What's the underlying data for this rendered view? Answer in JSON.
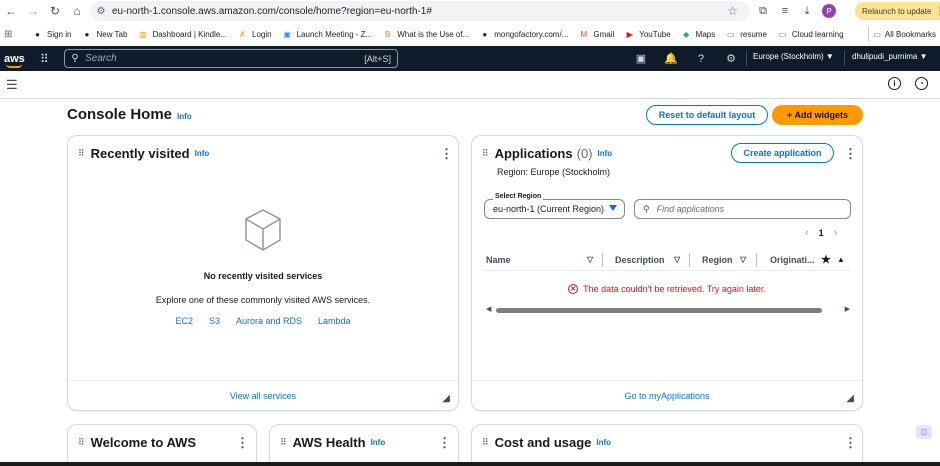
{
  "browser": {
    "url": "eu-north-1.console.aws.amazon.com/console/home?region=eu-north-1#",
    "relaunch_label": "Relaunch to update",
    "profile_initial": "P",
    "bookmarks": [
      {
        "label": "Sign in",
        "icon": "github-icon",
        "glyph": "●",
        "color": "#24292f"
      },
      {
        "label": "New Tab",
        "icon": "github-icon",
        "glyph": "●",
        "color": "#24292f"
      },
      {
        "label": "Dashboard | Kindle...",
        "icon": "chart-icon",
        "glyph": "▥",
        "color": "#f29900"
      },
      {
        "label": "Login",
        "icon": "person-icon",
        "glyph": "✗",
        "color": "#f29900"
      },
      {
        "label": "Launch Meeting - Z...",
        "icon": "zoom-icon",
        "glyph": "▣",
        "color": "#2d8cff"
      },
      {
        "label": "What is the Use of...",
        "icon": "blogger-icon",
        "glyph": "B",
        "color": "#f57c00"
      },
      {
        "label": "mongofactory.com/...",
        "icon": "github-icon",
        "glyph": "●",
        "color": "#24292f"
      },
      {
        "label": "Gmail",
        "icon": "gmail-icon",
        "glyph": "M",
        "color": "#ea4335"
      },
      {
        "label": "YouTube",
        "icon": "youtube-icon",
        "glyph": "▶",
        "color": "#ff0000"
      },
      {
        "label": "Maps",
        "icon": "maps-icon",
        "glyph": "◆",
        "color": "#34a853"
      },
      {
        "label": "resume",
        "icon": "folder-icon",
        "glyph": "▭",
        "color": "#5f6368"
      },
      {
        "label": "Cloud learning",
        "icon": "folder-icon",
        "glyph": "▭",
        "color": "#5f6368"
      }
    ],
    "all_bookmarks_label": "All Bookmarks"
  },
  "aws_nav": {
    "logo": "aws",
    "search_placeholder": "Search",
    "search_shortcut": "[Alt+S]",
    "region": "Europe (Stockholm) ▼",
    "user": "dhulipudi_purnima ▼"
  },
  "page": {
    "title": "Console Home",
    "info": "Info",
    "reset_button": "Reset to default layout",
    "add_widgets_button": "+ Add widgets"
  },
  "recently_visited": {
    "title": "Recently visited",
    "info": "Info",
    "empty_title": "No recently visited services",
    "empty_desc": "Explore one of these commonly visited AWS services.",
    "services": [
      "EC2",
      "S3",
      "Aurora and RDS",
      "Lambda"
    ],
    "footer_link": "View all services"
  },
  "applications": {
    "title": "Applications",
    "count": "(0)",
    "info": "Info",
    "create_button": "Create application",
    "region_line": "Region: Europe (Stockholm)",
    "select_label": "Select Region",
    "select_value": "eu-north-1 (Current Region)",
    "find_placeholder": "Find applications",
    "page_number": "1",
    "columns": [
      "Name",
      "Description",
      "Region",
      "Originati..."
    ],
    "error": "The data couldn't be retrieved. Try again later.",
    "footer_link": "Go to myApplications"
  },
  "bottom_cards": {
    "welcome_title": "Welcome to AWS",
    "health_title": "AWS Health",
    "health_info": "Info",
    "cost_title": "Cost and usage",
    "cost_info": "Info"
  },
  "colors": {
    "aws_nav_bg": "#0f1b2a",
    "link_blue": "#0972d3",
    "primary_orange": "#ff9900",
    "error_red": "#d91515"
  }
}
